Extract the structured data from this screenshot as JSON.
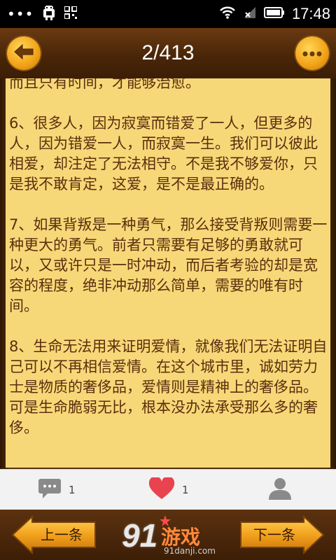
{
  "status_bar": {
    "dots": "•••",
    "time": "17:48"
  },
  "header": {
    "page_indicator": "2/413"
  },
  "content": {
    "paragraphs": [
      "而且只有时间，才能够治愈。",
      "6、很多人，因为寂寞而错爱了一人，但更多的人，因为错爱一人，而寂寞一生。我们可以彼此相爱，却注定了无法相守。不是我不够爱你，只是我不敢肯定，这爱，是不是最正确的。",
      "7、如果背叛是一种勇气，那么接受背叛则需要一种更大的勇气。前者只需要有足够的勇敢就可以，又或许只是一时冲动，而后者考验的却是宽容的程度，绝非冲动那么简单，需要的唯有时间。",
      "8、生命无法用来证明爱情，就像我们无法证明自己可以不再相信爱情。在这个城市里，诚如劳力士是物质的奢侈品，爱情则是精神上的奢侈品。可是生命脆弱无比，根本没办法承受那么多的奢侈。"
    ]
  },
  "actions": {
    "comment_count": "1",
    "like_count": "1"
  },
  "nav": {
    "prev_label": "上一条",
    "next_label": "下一条"
  },
  "logo": {
    "digits": "91",
    "word": "游戏",
    "url": "91danji.com"
  },
  "colors": {
    "paper": "#f6d878",
    "text": "#5a2e0e",
    "accent": "#f3a51a",
    "like": "#e8434f"
  }
}
